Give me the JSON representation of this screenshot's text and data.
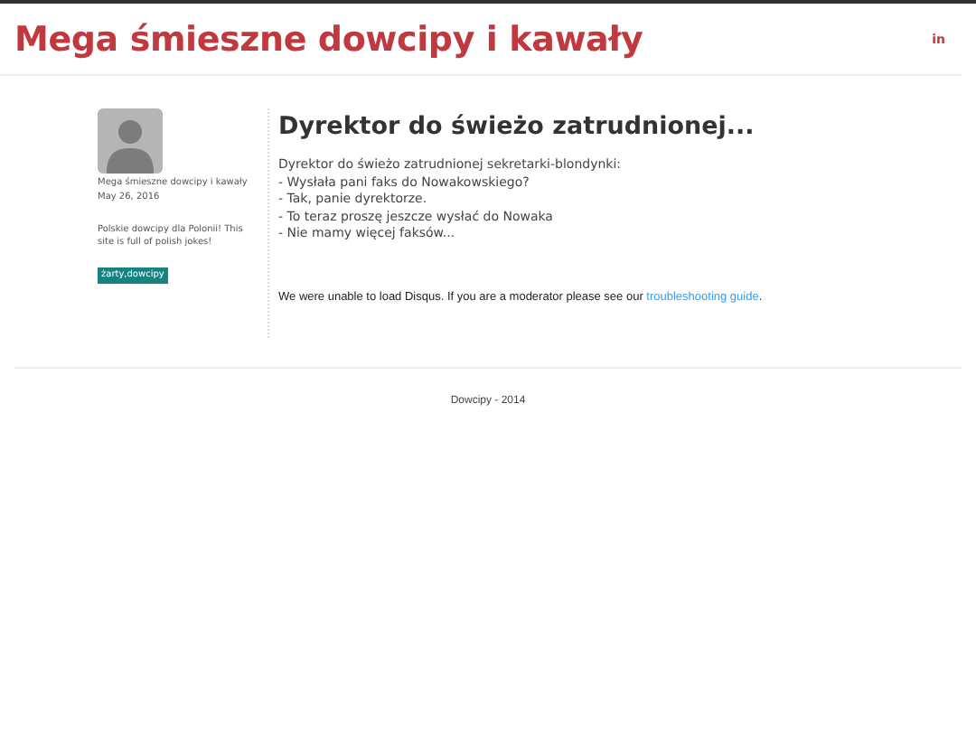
{
  "header": {
    "title": "Mega śmieszne dowcipy i kawały",
    "social_link": "in"
  },
  "sidebar": {
    "author": "Mega śmieszne dowcipy i kawały",
    "date": "May 26, 2016",
    "description": "Polskie dowcipy dla Polonii! This site is full of polish jokes!",
    "tag": "żarty,dowcipy"
  },
  "post": {
    "title": "Dyrektor do świeżo zatrudnionej...",
    "lines": [
      "Dyrektor do świeżo zatrudnionej sekretarki-blondynki:",
      "- Wysłała pani faks do Nowakowskiego?",
      "- Tak, panie dyrektorze.",
      "- To teraz proszę jeszcze wysłać do Nowaka",
      "- Nie mamy więcej faksów..."
    ]
  },
  "comments": {
    "message": "We were unable to load Disqus. If you are a moderator please see our",
    "link": "troubleshooting guide",
    "end": "."
  },
  "footer": "Dowcipy - 2014"
}
